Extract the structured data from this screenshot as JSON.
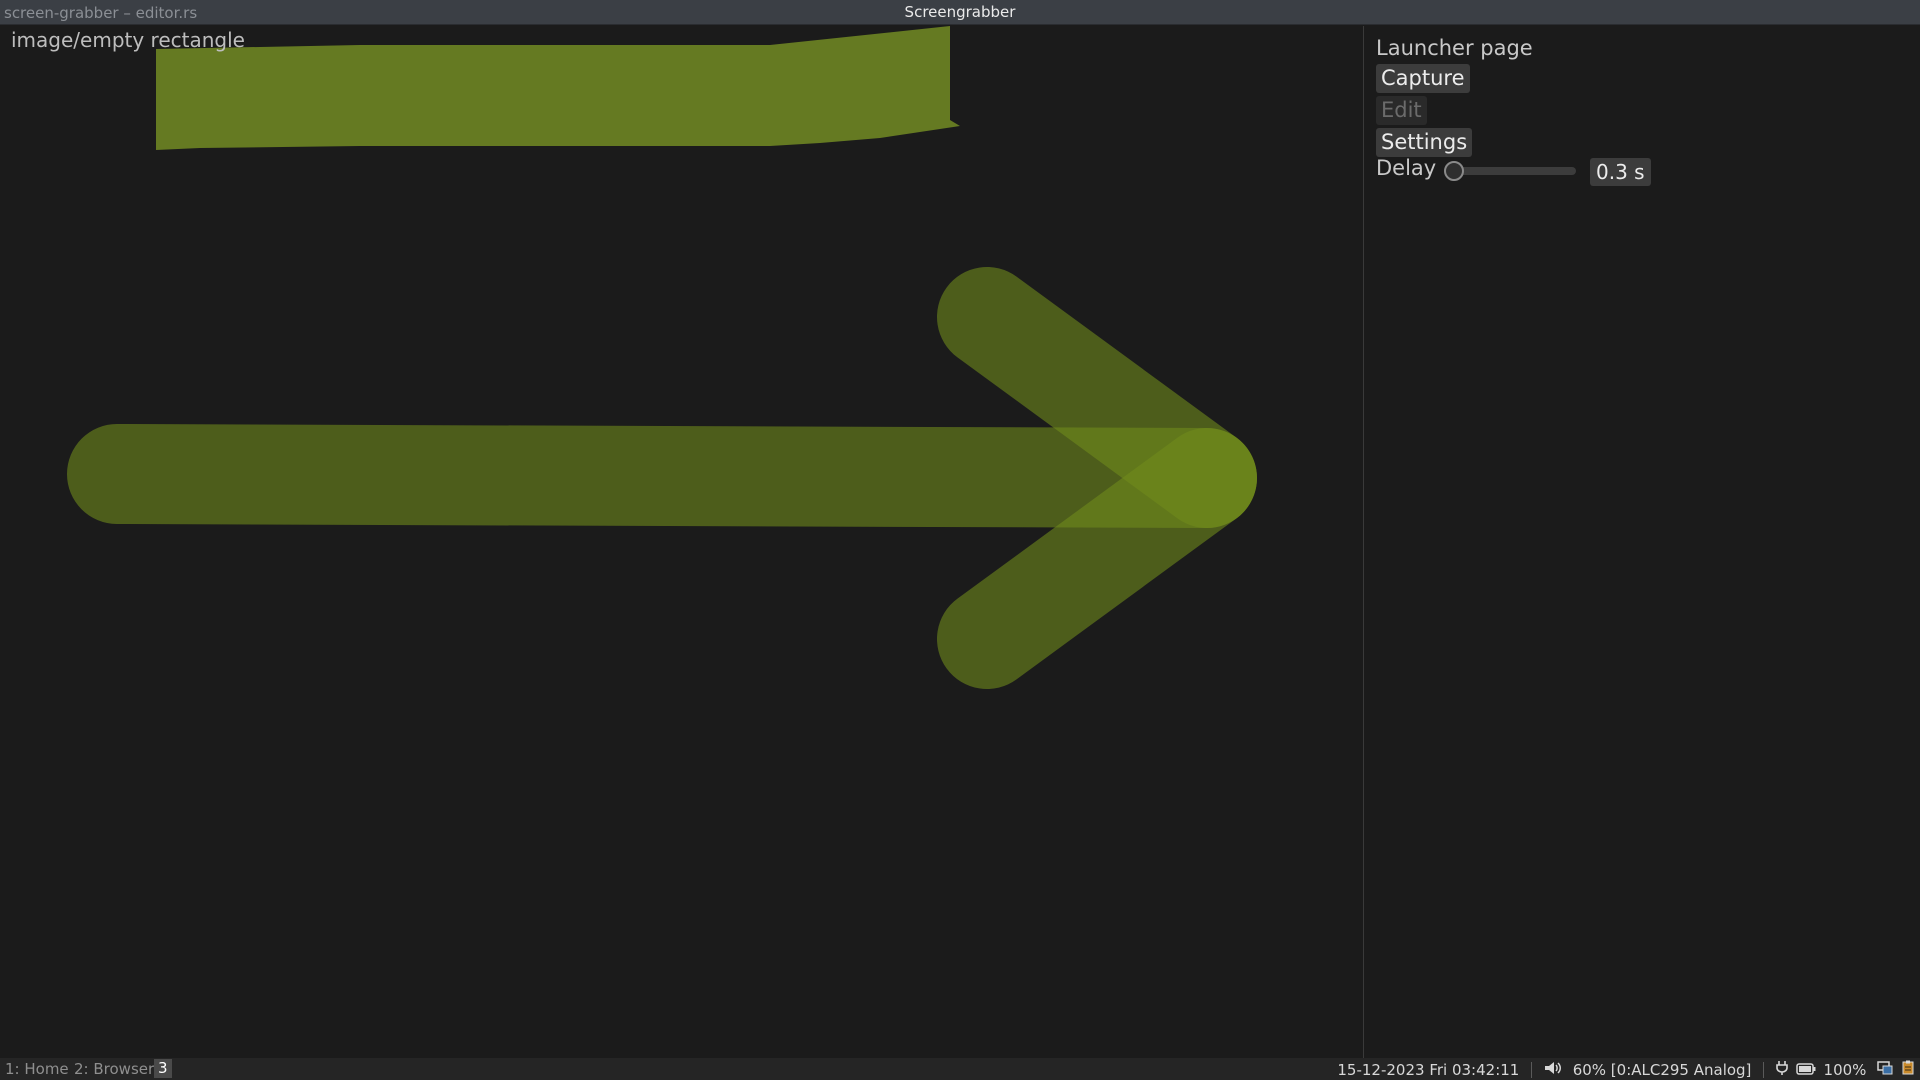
{
  "titlebar": {
    "window_name": "screen-grabber – editor.rs",
    "app_title": "Screengrabber"
  },
  "canvas": {
    "image_label": "image/empty rectangle",
    "annotation_color": "#6f8a1c"
  },
  "panel": {
    "heading": "Launcher page",
    "capture_label": "Capture",
    "edit_label": "Edit",
    "settings_label": "Settings",
    "delay_label": "Delay",
    "delay_value": "0.3 s",
    "delay_fraction": 0.03
  },
  "statusbar": {
    "workspaces": [
      {
        "label": "1: Home"
      },
      {
        "label": "2: Browser"
      },
      {
        "label": "3"
      }
    ],
    "datetime": "15-12-2023 Fri 03:42:11",
    "volume": "60% [0:ALC295 Analog]",
    "battery": "100%"
  },
  "icons": {
    "volume": "speaker-icon",
    "power": "plug-icon",
    "battery": "battery-icon",
    "tray1": "display-icon",
    "tray2": "clipboard-icon"
  }
}
